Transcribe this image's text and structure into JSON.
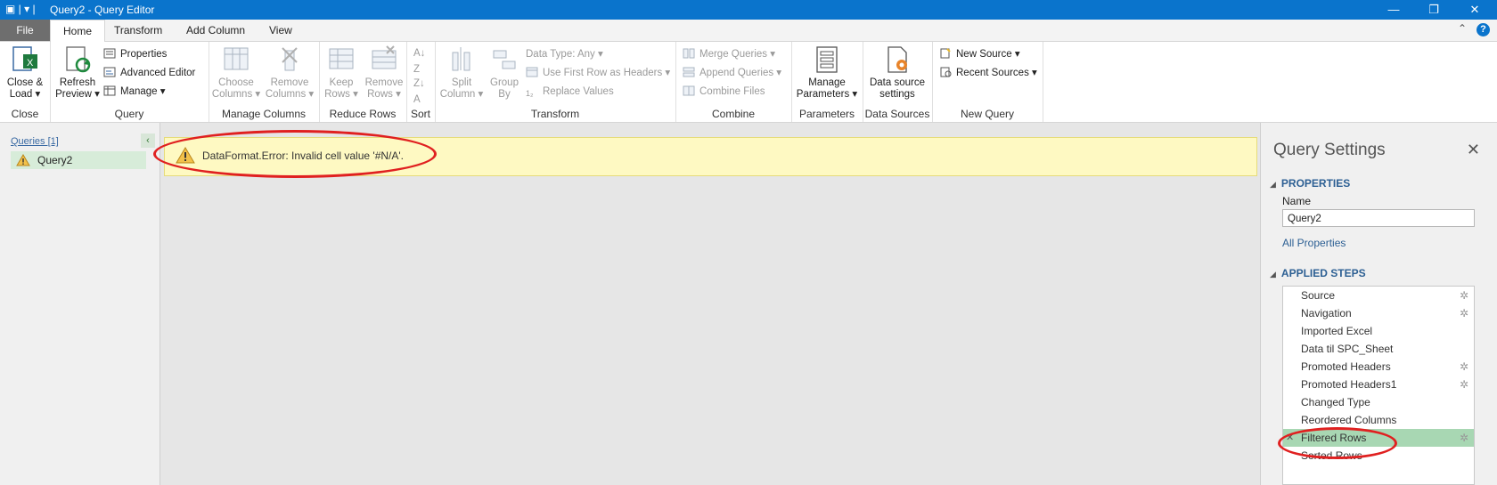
{
  "titlebar": {
    "title": "Query2 - Query Editor",
    "minimize": "—",
    "restore": "❐",
    "close": "✕"
  },
  "tabs": [
    {
      "label": "File"
    },
    {
      "label": "Home"
    },
    {
      "label": "Transform"
    },
    {
      "label": "Add Column"
    },
    {
      "label": "View"
    }
  ],
  "ribbon": {
    "close_group": {
      "btn_line1": "Close &",
      "btn_line2": "Load ▾",
      "label": "Close"
    },
    "query_group": {
      "refresh_line1": "Refresh",
      "refresh_line2": "Preview ▾",
      "properties": "Properties",
      "advanced_editor": "Advanced Editor",
      "manage": "Manage ▾",
      "label": "Query"
    },
    "manage_columns": {
      "choose_l1": "Choose",
      "choose_l2": "Columns ▾",
      "remove_l1": "Remove",
      "remove_l2": "Columns ▾",
      "label": "Manage Columns"
    },
    "reduce_rows": {
      "keep_l1": "Keep",
      "keep_l2": "Rows ▾",
      "remove_l1": "Remove",
      "remove_l2": "Rows ▾",
      "label": "Reduce Rows"
    },
    "sort": {
      "label": "Sort"
    },
    "transform": {
      "split_l1": "Split",
      "split_l2": "Column ▾",
      "group_l1": "Group",
      "group_l2": "By",
      "data_type": "Data Type: Any ▾",
      "first_row": "Use First Row as Headers ▾",
      "replace": "Replace Values",
      "label": "Transform"
    },
    "combine": {
      "merge": "Merge Queries ▾",
      "append": "Append Queries ▾",
      "combine_files": "Combine Files",
      "label": "Combine"
    },
    "parameters": {
      "btn_l1": "Manage",
      "btn_l2": "Parameters ▾",
      "label": "Parameters"
    },
    "data_sources": {
      "btn_l1": "Data source",
      "btn_l2": "settings",
      "label": "Data Sources"
    },
    "new_query": {
      "new_source": "New Source ▾",
      "recent_sources": "Recent Sources ▾",
      "label": "New Query"
    }
  },
  "queries_pane": {
    "header": "Queries [1]",
    "items": [
      {
        "name": "Query2"
      }
    ]
  },
  "error": {
    "message": "DataFormat.Error: Invalid cell value '#N/A'."
  },
  "query_settings": {
    "title": "Query Settings",
    "properties_header": "PROPERTIES",
    "name_label": "Name",
    "name_value": "Query2",
    "all_properties": "All Properties",
    "applied_steps_header": "APPLIED STEPS",
    "steps": [
      {
        "name": "Source"
      },
      {
        "name": "Navigation"
      },
      {
        "name": "Imported Excel"
      },
      {
        "name": "Data til SPC_Sheet"
      },
      {
        "name": "Promoted Headers"
      },
      {
        "name": "Promoted Headers1"
      },
      {
        "name": "Changed Type"
      },
      {
        "name": "Reordered Columns"
      },
      {
        "name": "Filtered Rows"
      },
      {
        "name": "Sorted Rows"
      }
    ]
  },
  "colors": {
    "titlebar": "#0a74cc",
    "error_bg": "#fef9c2",
    "selected_step": "#a8d7b3",
    "annotation": "#e02020"
  }
}
